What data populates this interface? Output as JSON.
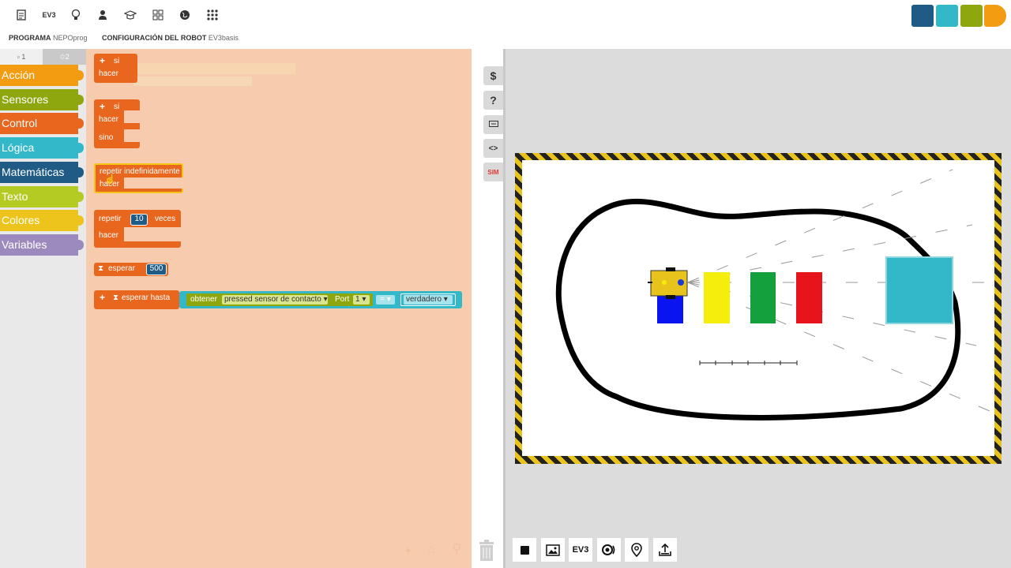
{
  "top_icons": [
    "document-icon",
    "EV3",
    "lightbulb-icon",
    "person-icon",
    "graduation-icon",
    "grid-icon",
    "globe-icon",
    "apps-icon"
  ],
  "tabs": {
    "program_label": "PROGRAMA",
    "program_name": "NEPOprog",
    "config_label": "CONFIGURACIÓN DEL ROBOT",
    "config_name": "EV3basis"
  },
  "levels": {
    "l1": "1",
    "l2": "2"
  },
  "categories": [
    {
      "label": "Acción",
      "color": "#f39c12"
    },
    {
      "label": "Sensores",
      "color": "#8fa70f"
    },
    {
      "label": "Control",
      "color": "#e8661d"
    },
    {
      "label": "Lógica",
      "color": "#33b8ca"
    },
    {
      "label": "Matemáticas",
      "color": "#1f5b85"
    },
    {
      "label": "Texto",
      "color": "#b3cb22"
    },
    {
      "label": "Colores",
      "color": "#ecc41c"
    },
    {
      "label": "Variables",
      "color": "#9c8abf"
    }
  ],
  "blocks": {
    "si": "si",
    "hacer": "hacer",
    "sino": "sino",
    "repetir_indef": "repetir indefinidamente",
    "repetir": "repetir",
    "repetir_count": "10",
    "veces": "veces",
    "esperar": "esperar",
    "esperar_ms": "500",
    "esperar_hasta": "esperar hasta",
    "obtener": "obtener",
    "pressed": "pressed",
    "sensor": "sensor de contacto",
    "port": "Port",
    "port_num": "1",
    "eq": "=",
    "verdadero": "verdadero"
  },
  "side_buttons": [
    "$",
    "?",
    "comment-icon",
    "<>",
    "SIM"
  ],
  "sim_controls": [
    "stop-icon",
    "image-icon",
    "EV3",
    "sensor-icon",
    "location-icon",
    "export-icon"
  ],
  "colors": {
    "control": "#e8661d",
    "logic": "#33b8ca",
    "sensor": "#8fa70f",
    "math": "#1f5b85",
    "flyout_bg": "#f7cbad",
    "obstacle_cyan": "#33b8ca",
    "obj_yellow": "#f5ee0d",
    "obj_green": "#14a03c",
    "obj_red": "#e8141b",
    "obj_blue": "#0a14f0"
  }
}
